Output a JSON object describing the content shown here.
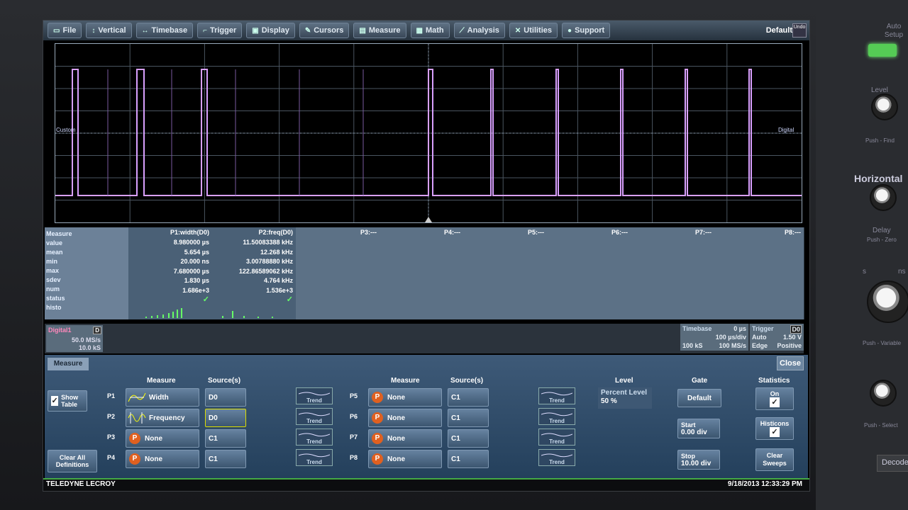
{
  "menubar": {
    "items": [
      {
        "label": "File",
        "icon": "folder-icon"
      },
      {
        "label": "Vertical",
        "icon": "vertical-icon"
      },
      {
        "label": "Timebase",
        "icon": "timebase-icon"
      },
      {
        "label": "Trigger",
        "icon": "trigger-icon"
      },
      {
        "label": "Display",
        "icon": "display-icon"
      },
      {
        "label": "Cursors",
        "icon": "cursors-icon"
      },
      {
        "label": "Measure",
        "icon": "measure-icon"
      },
      {
        "label": "Math",
        "icon": "math-icon"
      },
      {
        "label": "Analysis",
        "icon": "analysis-icon"
      },
      {
        "label": "Utilities",
        "icon": "utilities-icon"
      },
      {
        "label": "Support",
        "icon": "support-icon"
      }
    ],
    "default_label": "Default",
    "undo_label": "Undo"
  },
  "waveform": {
    "left_label": "Custom",
    "right_label": "Digital",
    "colors": {
      "trace": "#d9a0ff",
      "trace_dim": "#7a5aa0",
      "grid": "#8899aa"
    }
  },
  "measure_table": {
    "row_labels": [
      "Measure",
      "value",
      "mean",
      "min",
      "max",
      "sdev",
      "num",
      "status",
      "histo"
    ],
    "params": [
      {
        "header": "P1:width(D0)",
        "values": [
          "8.980000 µs",
          "5.654 µs",
          "20.000 ns",
          "7.680000 µs",
          "1.830 µs",
          "1.686e+3",
          "✓"
        ]
      },
      {
        "header": "P2:freq(D0)",
        "values": [
          "11.50083388 kHz",
          "12.268 kHz",
          "3.00788880 kHz",
          "122.86589062 kHz",
          "4.764 kHz",
          "1.536e+3",
          "✓"
        ]
      },
      {
        "header": "P3:---",
        "values": []
      },
      {
        "header": "P4:---",
        "values": []
      },
      {
        "header": "P5:---",
        "values": []
      },
      {
        "header": "P6:---",
        "values": []
      },
      {
        "header": "P7:---",
        "values": []
      },
      {
        "header": "P8:---",
        "values": []
      }
    ]
  },
  "status": {
    "digital": {
      "name": "Digital1",
      "tag": "D",
      "line1": "50.0 MS/s",
      "line2": "10.0 kS"
    },
    "timebase": {
      "title": "Timebase",
      "offset": "0 µs",
      "per_div": "100 µs/div",
      "samples": "100 kS",
      "rate": "100 MS/s"
    },
    "trigger": {
      "title": "Trigger",
      "tag": "D0",
      "mode": "Auto",
      "level": "1.50 V",
      "type": "Edge",
      "slope": "Positive"
    }
  },
  "dialog": {
    "tab": "Measure",
    "close_label": "Close",
    "show_table_label": "Show Table",
    "clear_all_label": "Clear All Definitions",
    "headers": {
      "measure": "Measure",
      "sources": "Source(s)",
      "level": "Level",
      "gate": "Gate",
      "statistics": "Statistics"
    },
    "left_rows": [
      {
        "p": "P1",
        "measure": "Width",
        "source": "D0",
        "icon": "width-icon"
      },
      {
        "p": "P2",
        "measure": "Frequency",
        "source": "D0",
        "icon": "frequency-icon"
      },
      {
        "p": "P3",
        "measure": "None",
        "source": "C1",
        "icon": "p-icon"
      },
      {
        "p": "P4",
        "measure": "None",
        "source": "C1",
        "icon": "p-icon"
      }
    ],
    "right_rows": [
      {
        "p": "P5",
        "measure": "None",
        "source": "C1"
      },
      {
        "p": "P6",
        "measure": "None",
        "source": "C1"
      },
      {
        "p": "P7",
        "measure": "None",
        "source": "C1"
      },
      {
        "p": "P8",
        "measure": "None",
        "source": "C1"
      }
    ],
    "trend_label": "Trend",
    "level": {
      "title": "Percent Level",
      "value": "50 %"
    },
    "gate": {
      "default_label": "Default",
      "start_label": "Start",
      "start_value": "0.00 div",
      "stop_label": "Stop",
      "stop_value": "10.00 div"
    },
    "statistics": {
      "on_label": "On",
      "histicons_label": "Histicons",
      "clear_sweeps_label": "Clear Sweeps"
    }
  },
  "footer": {
    "brand": "TELEDYNE LECROY",
    "datetime": "9/18/2013 12:33:29 PM"
  },
  "front_panel": {
    "auto_setup": "Auto Setup",
    "level": "Level",
    "push_find": "Push - Find",
    "horizontal": "Horizontal",
    "delay": "Delay",
    "push_zero": "Push - Zero",
    "s": "s",
    "ns": "ns",
    "push_variable": "Push - Variable",
    "push_select": "Push - Select",
    "decode": "Decode"
  }
}
